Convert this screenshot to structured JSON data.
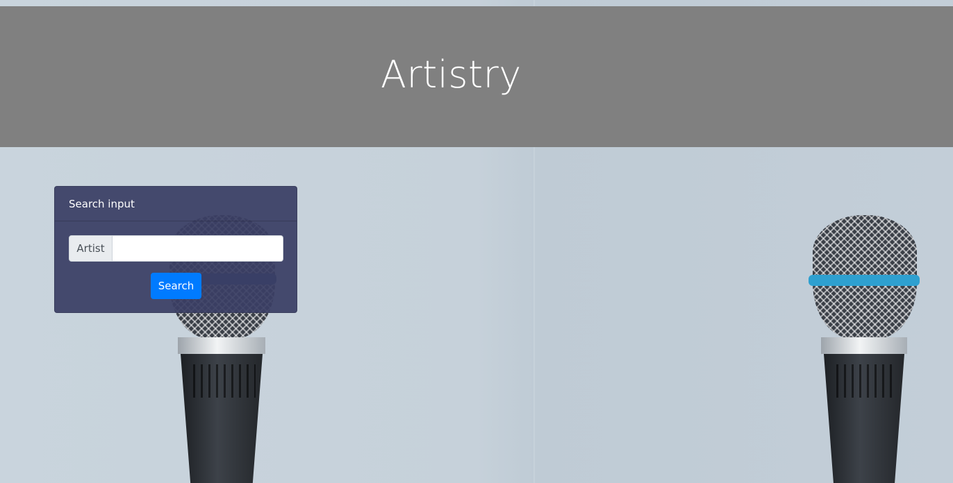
{
  "header": {
    "title": "Artistry"
  },
  "search_card": {
    "title": "Search input",
    "artist_label": "Artist",
    "artist_value": "",
    "artist_placeholder": "",
    "search_button": "Search"
  },
  "colors": {
    "header_bg": "#808080",
    "card_bg": "#3a3e64",
    "button_bg": "#007bff",
    "mic_ring_left": "#2a4f7a",
    "mic_ring_right": "#2ea0d0"
  },
  "background": {
    "subject": "microphone-image"
  }
}
